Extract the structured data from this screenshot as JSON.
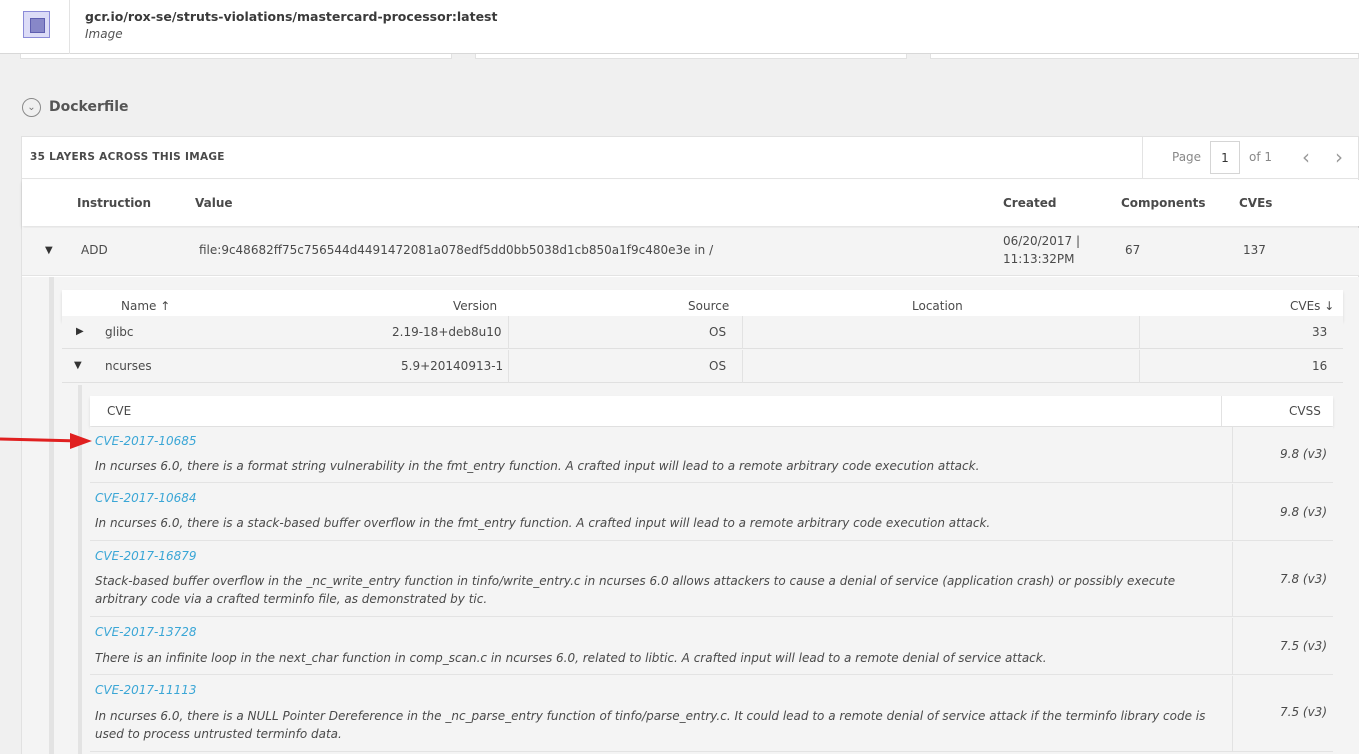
{
  "header": {
    "image_name": "gcr.io/rox-se/struts-violations/mastercard-processor:latest",
    "type_label": "Image"
  },
  "dockerfile": {
    "section_title": "Dockerfile",
    "layers_count_label": "35 LAYERS ACROSS THIS IMAGE",
    "pagination": {
      "page_label": "Page",
      "current_page": "1",
      "of_label": "of 1"
    },
    "columns": [
      "Instruction",
      "Value",
      "Created",
      "Components",
      "CVEs"
    ],
    "layer": {
      "instruction": "ADD",
      "value": "file:9c48682ff75c756544d4491472081a078edf5dd0bb5038d1cb850a1f9c480e3e in /",
      "created_date": "06/20/2017 |",
      "created_time": "11:13:32PM",
      "components": "67",
      "cves": "137"
    }
  },
  "components": {
    "columns": {
      "name": "Name ↑",
      "version": "Version",
      "source": "Source",
      "location": "Location",
      "cves": "CVEs ↓"
    },
    "rows": [
      {
        "name": "glibc",
        "version": "2.19-18+deb8u10",
        "source": "OS",
        "location": "",
        "cves": "33"
      },
      {
        "name": "ncurses",
        "version": "5.9+20140913-1",
        "source": "OS",
        "location": "",
        "cves": "16"
      }
    ]
  },
  "cve_table": {
    "columns": {
      "cve": "CVE",
      "cvss": "CVSS"
    },
    "rows": [
      {
        "id": "CVE-2017-10685",
        "description": "In ncurses 6.0, there is a format string vulnerability in the fmt_entry function. A crafted input will lead to a remote arbitrary code execution attack.",
        "score": "9.8 (v3)"
      },
      {
        "id": "CVE-2017-10684",
        "description": "In ncurses 6.0, there is a stack-based buffer overflow in the fmt_entry function. A crafted input will lead to a remote arbitrary code execution attack.",
        "score": "9.8 (v3)"
      },
      {
        "id": "CVE-2017-16879",
        "description": "Stack-based buffer overflow in the _nc_write_entry function in tinfo/write_entry.c in ncurses 6.0 allows attackers to cause a denial of service (application crash) or possibly execute arbitrary code via a crafted terminfo file, as demonstrated by tic.",
        "score": "7.8 (v3)"
      },
      {
        "id": "CVE-2017-13728",
        "description": "There is an infinite loop in the next_char function in comp_scan.c in ncurses 6.0, related to libtic. A crafted input will lead to a remote denial of service attack.",
        "score": "7.5 (v3)"
      },
      {
        "id": "CVE-2017-11113",
        "description": "In ncurses 6.0, there is a NULL Pointer Dereference in the _nc_parse_entry function of tinfo/parse_entry.c. It could lead to a remote denial of service attack if the terminfo library code is used to process untrusted terminfo data.",
        "score": "7.5 (v3)"
      }
    ]
  },
  "colors": {
    "link": "#3aa6d6",
    "annotation_arrow": "#e02020",
    "image_icon": "#8787c8"
  }
}
